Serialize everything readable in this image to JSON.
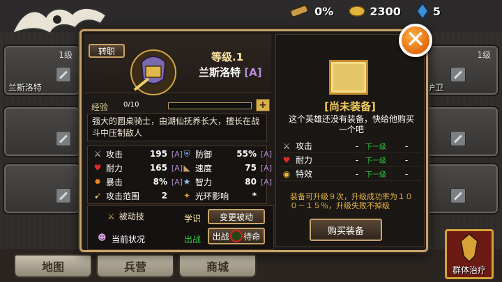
{
  "resources": {
    "scroll_value": "0%",
    "gold_value": "2300",
    "gem_value": "5"
  },
  "side_cards": {
    "left_top_level": "1级",
    "left_top_name": "兰斯洛特",
    "right_top_level": "1级",
    "right_top_name": "护卫"
  },
  "bottom_nav": {
    "map": "地图",
    "barracks": "兵营",
    "shop": "商城",
    "group_heal": "群体治疗"
  },
  "hero": {
    "transfer_label": "转职",
    "level_text": "等级.1",
    "name": "兰斯洛特",
    "rank": "[A]",
    "exp_label": "经验",
    "exp_value": "0/10",
    "exp_fraction": 0,
    "exp_plus": "+",
    "description": "强大的圆桌骑士，由湖仙抚养长大，擅长在战斗中压制敌人"
  },
  "stats": [
    {
      "icon": "sword-icon",
      "label": "攻击",
      "value": "195",
      "rank": "[A]"
    },
    {
      "icon": "heart-icon",
      "label": "耐力",
      "value": "165",
      "rank": "[A]"
    },
    {
      "icon": "crit-icon",
      "label": "暴击",
      "value": "8%",
      "rank": "[A]"
    },
    {
      "icon": "range-icon",
      "label": "攻击范围",
      "value": "2",
      "rank": ""
    },
    {
      "icon": "shield-icon",
      "label": "防御",
      "value": "55%",
      "rank": "[A]"
    },
    {
      "icon": "boot-icon",
      "label": "速度",
      "value": "75",
      "rank": "[A]"
    },
    {
      "icon": "wisdom-icon",
      "label": "智力",
      "value": "80",
      "rank": "[A]"
    },
    {
      "icon": "aura-icon",
      "label": "光环影响",
      "value": "*",
      "rank": ""
    }
  ],
  "passive": {
    "label": "被动技",
    "learn_label": "学识",
    "change_button": "变更被动",
    "status_label": "当前状况",
    "status_value": "出战",
    "toggle_left": "出战",
    "toggle_right": "待命"
  },
  "equipment": {
    "status": "[尚未装备]",
    "description": "这个英雄还没有装备，快给他购买一个吧",
    "rows": [
      {
        "icon": "sword-icon",
        "label": "攻击",
        "current": "-",
        "next": "下一级",
        "next_value": "-"
      },
      {
        "icon": "heart-icon",
        "label": "耐力",
        "current": "-",
        "next": "下一级",
        "next_value": "-"
      },
      {
        "icon": "effect-icon",
        "label": "特效",
        "current": "-",
        "next": "下一级",
        "next_value": "-"
      }
    ],
    "upgrade_info": "装备可升级９次，升级成功率为１００－１５％，升级失败不掉级",
    "buy_button": "购买装备"
  },
  "colors": {
    "accent_gold": "#c9a468",
    "rank_purple": "#b58cd4",
    "status_green": "#32c845",
    "close_orange": "#e26a12"
  }
}
